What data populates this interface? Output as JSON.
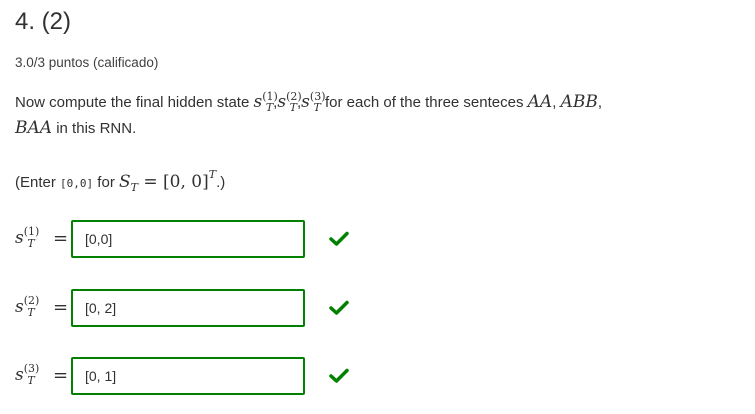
{
  "problem": {
    "title": "4. (2)",
    "score": "3.0/3 puntos (calificado)"
  },
  "question": {
    "text_before": "Now compute the final hidden state ",
    "s_sym": "s",
    "t_sym": "T",
    "sup1": "(1)",
    "sup2": "(2)",
    "sup3": "(3)",
    "comma": ",",
    "text_middle": " for each of the three senteces ",
    "s1": "AA",
    "sep1": ", ",
    "s2": "ABB",
    "sep2": ",",
    "s3": "BAA",
    "text_after": " in this RNN."
  },
  "hint": {
    "prefix": "(Enter ",
    "code": "[0,0]",
    "middle": " for ",
    "S_sym": "S",
    "eq_expr": " = [0, 0]",
    "T_sup": "T",
    "suffix": ".)"
  },
  "answers": [
    {
      "sup": "(1)",
      "value": "[0,0]",
      "status": "correct"
    },
    {
      "sup": "(2)",
      "value": "[0, 2]",
      "status": "correct"
    },
    {
      "sup": "(3)",
      "value": "[0, 1]",
      "status": "correct"
    }
  ],
  "colors": {
    "correct_border": "#008100",
    "check": "#008100",
    "text": "#313131"
  },
  "icons": {
    "status": "checkmark-icon"
  }
}
